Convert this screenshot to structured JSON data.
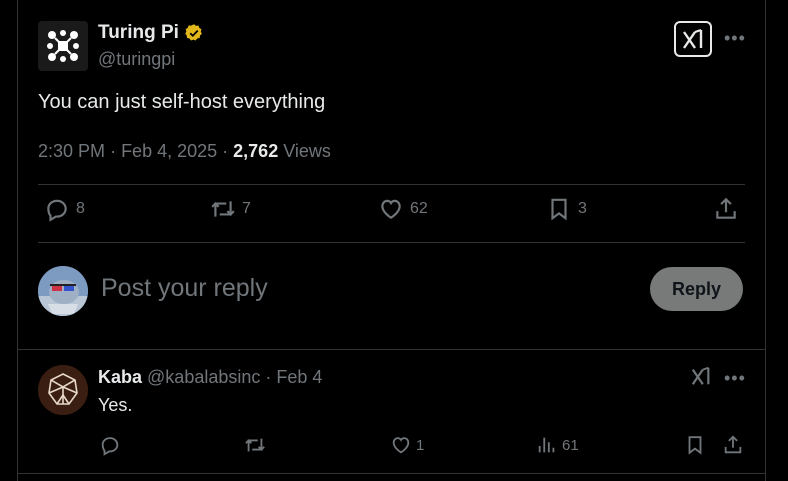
{
  "main_tweet": {
    "author_name": "Turing Pi",
    "author_handle": "@turingpi",
    "text": "You can just self-host everything",
    "time": "2:30 PM",
    "date": "Feb 4, 2025",
    "views_count": "2,762",
    "views_label": "Views",
    "actions": {
      "replies": "8",
      "reposts": "7",
      "likes": "62",
      "bookmarks": "3"
    }
  },
  "compose": {
    "placeholder": "Post your reply",
    "reply_button": "Reply"
  },
  "reply_tweet": {
    "author_name": "Kaba",
    "author_handle": "@kabalabsinc",
    "date": "Feb 4",
    "text": "Yes.",
    "actions": {
      "replies": "",
      "reposts": "",
      "likes": "1",
      "views": "61"
    }
  },
  "colors": {
    "background": "#000000",
    "text_primary": "#e7e9ea",
    "text_secondary": "#71767b",
    "border": "#2f3336",
    "verified_gold": "#e2b719",
    "reply_button_bg": "#787a7a"
  },
  "icons": [
    "turingpi-logo",
    "verified-badge-icon",
    "grok-icon",
    "more-icon",
    "reply-icon",
    "repost-icon",
    "like-icon",
    "bookmark-icon",
    "share-icon",
    "views-icon"
  ]
}
